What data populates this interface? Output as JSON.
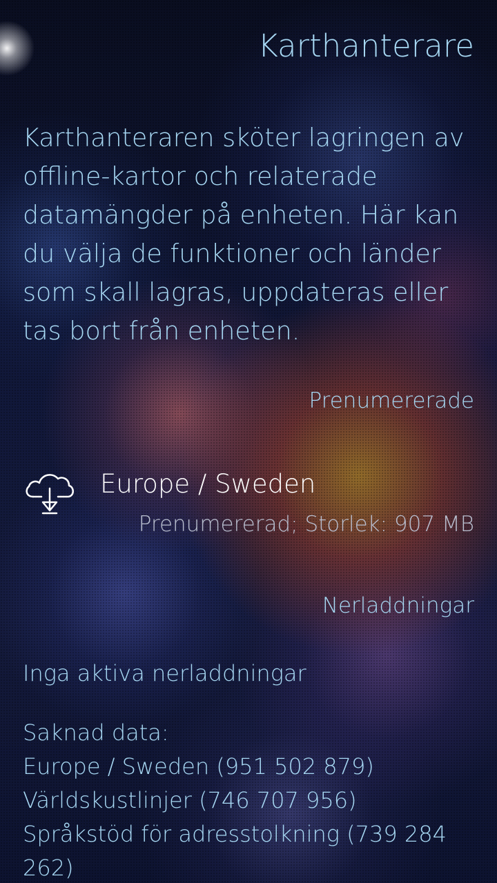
{
  "page": {
    "title": "Karthanterare",
    "intro": "Karthanteraren sköter lagringen av offline-kartor och relaterade datamängder på enheten. Här kan du välja de funktioner och länder som skall lagras, uppdateras eller tas bort från enheten."
  },
  "subscribed": {
    "header": "Prenumererade",
    "items": [
      {
        "name": "Europe / Sweden",
        "status": "Prenumererad; Storlek: 907 MB",
        "icon": "cloud-download-icon"
      }
    ]
  },
  "downloads": {
    "header": "Nerladdningar",
    "none_text": "Inga aktiva nerladdningar",
    "missing_label": "Saknad data:",
    "missing_items": [
      "Europe / Sweden (951 502 879)",
      "Världskustlinjer (746 707 956)",
      "Språkstöd för adresstolkning (739 284 262)"
    ]
  },
  "colors": {
    "accent": "#a7d8f3",
    "primary_text": "#ffffff",
    "secondary_text": "#b9bfd0"
  }
}
